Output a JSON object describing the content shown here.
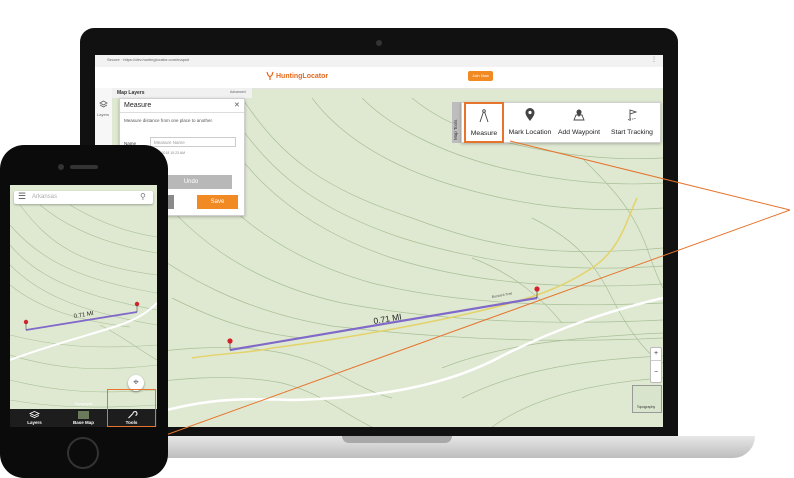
{
  "browser": {
    "url": "Secure · https://dev.huntinglocator.com/maps#"
  },
  "site": {
    "logo_text": "HuntingLocator",
    "header_button": "Join Now"
  },
  "left_rail": {
    "layers_label": "Layers"
  },
  "layers_panel": {
    "title": "Map Layers",
    "tab_label": "Advanced"
  },
  "measure_dialog": {
    "title": "Measure",
    "close_glyph": "✕",
    "description": "Measure distance from one place to another.",
    "name_label": "Name",
    "name_placeholder": "Measure Name",
    "date_text": "Jan 20 2018 10:23 AM",
    "undo_label": "Undo",
    "save_label": "Save"
  },
  "map_tools": {
    "tab_label": "Map Tools",
    "tools": [
      {
        "label": "Measure",
        "icon": "compass-icon",
        "selected": true
      },
      {
        "label": "Mark Location",
        "icon": "map-pin-icon"
      },
      {
        "label": "Add Waypoint",
        "icon": "waypoint-icon"
      },
      {
        "label": "Start Tracking",
        "icon": "tracking-icon"
      }
    ]
  },
  "map": {
    "distance_label": "0.71 MI",
    "road_label": "Buzzard Trail",
    "zoom_in": "+",
    "zoom_out": "−",
    "locate_glyph": "⊕",
    "basemap_label": "Topography"
  },
  "phone": {
    "search_placeholder": "Arkansas",
    "menu_glyph": "☰",
    "search_glyph": "⚲",
    "distance_label": "0.71 MI",
    "locate_glyph": "⌖",
    "tabs": [
      {
        "label": "Layers"
      },
      {
        "label": "Base Map",
        "sublabel": "Topography"
      },
      {
        "label": "Tools"
      }
    ]
  },
  "colors": {
    "accent": "#e6742d",
    "map_bg": "#dfe9d2",
    "contour": "#a9bf96",
    "route": "#8069c8",
    "road": "#e4d26a"
  }
}
